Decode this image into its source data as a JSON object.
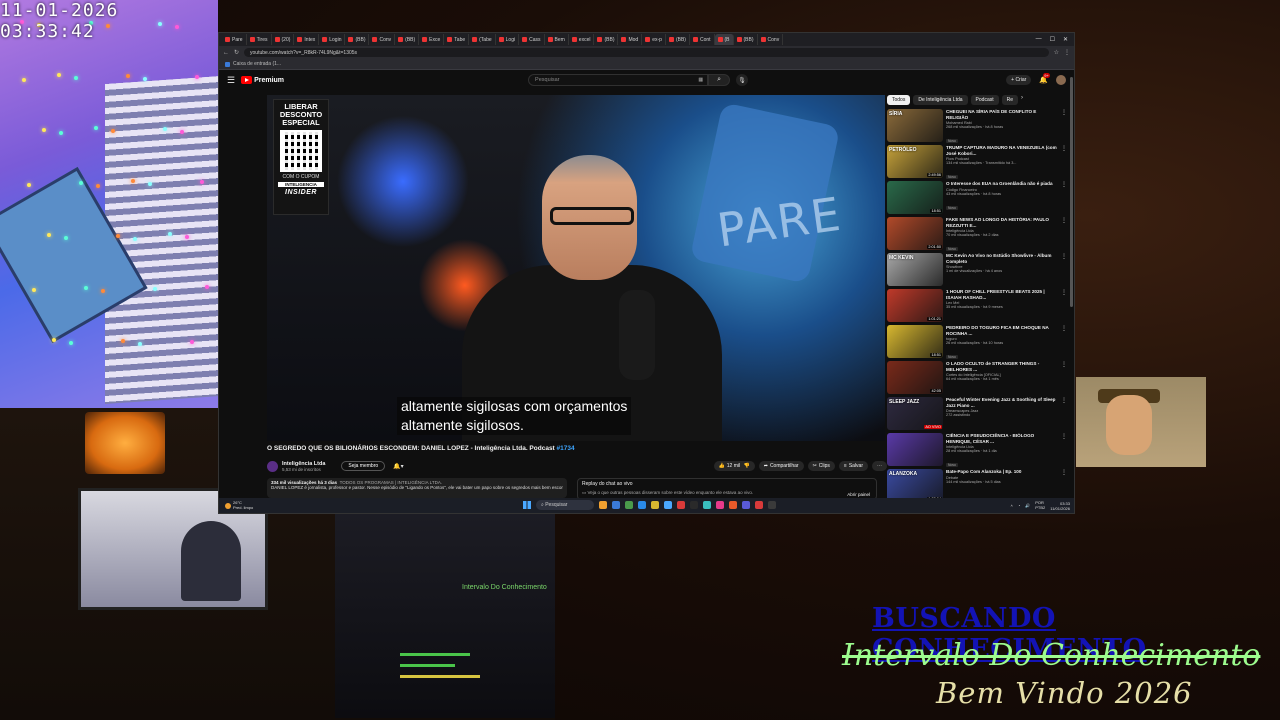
{
  "overlay": {
    "timestamp": "11-01-2026 03:33:42",
    "ticker_line1": "BUSCANDO CONHECIMENTO",
    "ticker_line2": "Intervalo Do Conhecimento",
    "ticker_line3": "Bem Vindo 2026"
  },
  "browser": {
    "tabs": [
      "Pare",
      "Tires",
      "(20)",
      "Intex",
      "Login",
      "(BB)",
      "Conv",
      "(BB)",
      "Exce",
      "Tabe",
      "(Tabe",
      "Logi",
      "Cass",
      "Bem",
      "excel",
      "(BB)",
      "Mod",
      "ex-p",
      "(BB)",
      "Cont",
      "(B",
      "(BB)",
      "Conv"
    ],
    "active_tab_index": 20,
    "url": "youtube.com/watch?v=_R8kR-74L9Ng&t=1305s",
    "bookmark": "Caixa de entrada (1..."
  },
  "youtube": {
    "logo_text": "Premium",
    "search_placeholder": "Pesquisar",
    "create_label": "Criar",
    "notif_count": "9+",
    "promo": {
      "line1": "LIBERAR DESCONTO ESPECIAL",
      "line2": "COM O CUPOM",
      "coupon": "INTELIGENCIA",
      "brand": "INSIDER"
    },
    "scene_text": "PARE",
    "subtitle_line1": "altamente sigilosas com orçamentos",
    "subtitle_line2": "altamente sigilosos.",
    "title": "O SEGREDO QUE OS BILIONÁRIOS ESCONDEM: DANIEL LOPEZ - Inteligência Ltda. Podcast",
    "title_hash": "#1734",
    "channel_name": "Inteligência Ltda",
    "channel_subs": "5,53 mi de inscritos",
    "join_label": "Seja membro",
    "actions": {
      "likes": "12 mil",
      "share": "Compartilhar",
      "clip": "Clips",
      "save": "Salvar"
    },
    "description_meta": "334 mil visualizações há 3 dias",
    "description_tags": "TODOS OS PROGRAMAS | INTELIGÊNCIA LTDA.",
    "description_body": "DANIEL LOPEZ é jornalista, professor e pastor. Nesse episódio de \"Ligando os Pontos\", ele vai bater um papo sobre os segredos mais bem escondidos dos bilionários. Já o Vilela não consegue guardar nem o segredo do cadeado de sua bicicleta, que obviamente foi roubada! ...mais",
    "chat_title": "Replay do chat ao vivo",
    "chat_text": "Veja o que outras pessoas disseram sobre este vídeo enquanto ele estava ao vivo.",
    "chat_button": "Abrir painel",
    "chips": [
      "Todos",
      "De Inteligência Ltda",
      "Podcast",
      "Re"
    ],
    "recommendations": [
      {
        "title": "CHEGUEI NA SÍRIA PAÍS DE CONFLITO E RELIGIÃO",
        "channel": "Mohamed Rabi",
        "meta": "268 mil visualizações · há 8 horas",
        "badge": "Novo",
        "duration": "",
        "color": "#8a6a3a",
        "label": "SÍRIA"
      },
      {
        "title": "TRUMP CAPTURA MADURO NA VENEZUELA (com José Kobori...",
        "channel": "Flow Podcast",
        "meta": "134 mil visualizações · Transmitido há 3...",
        "badge": "Novo",
        "duration": "2:49:56",
        "color": "#c6a23a",
        "label": "PETRÓLEO"
      },
      {
        "title": "O Interesse dos EUA na Groenlândia não é piada",
        "channel": "Código Financeiro",
        "meta": "43 mil visualizações · há 8 horas",
        "badge": "Novo",
        "duration": "18:51",
        "color": "#2a6a4a",
        "label": ""
      },
      {
        "title": "FAKE NEWS AO LONGO DA HISTÓRIA: PAULO REZZUTTI E...",
        "channel": "Inteligência Ltda",
        "meta": "70 mil visualizações · há 2 dias",
        "badge": "Novo",
        "duration": "2:01:50",
        "color": "#b24a2a",
        "label": ""
      },
      {
        "title": "MC Kevin Ao Vivo no Estúdio Showlivre - Álbum Completo",
        "channel": "Showlivre",
        "meta": "1 mi de visualizações · há 4 anos",
        "badge": "",
        "duration": "",
        "color": "#a8a8a8",
        "label": "MC KEVIN"
      },
      {
        "title": "1 HOUR OF CHILL FREESTYLE BEATS 2025 | ISAIAH RASHAD...",
        "channel": "Lex Mel",
        "meta": "35 mil visualizações · há 9 meses",
        "badge": "",
        "duration": "1:01:21",
        "color": "#c03a2a",
        "label": ""
      },
      {
        "title": "PEDREIRO DO TOGURO FICA EM CHOQUE NA ROCINHA ...",
        "channel": "toguro",
        "meta": "26 mil visualizações · há 10 horas",
        "badge": "Novo",
        "duration": "18:51",
        "color": "#d8b830",
        "label": ""
      },
      {
        "title": "O LADO OCULTO de STRANGER THINGS - MELHORES ...",
        "channel": "Cortes do Inteligência [OFICIAL]",
        "meta": "64 mil visualizações · há 1 mês",
        "badge": "",
        "duration": "42:05",
        "color": "#7a2a1a",
        "label": ""
      },
      {
        "title": "Peaceful Winter Evening Jazz & Soothing of Sleep Jazz Piano ...",
        "channel": "Dreamscapes Jazz",
        "meta": "272 assistindo",
        "badge": "",
        "duration": "AO VIVO",
        "color": "#2e2a40",
        "label": "SLEEP JAZZ"
      },
      {
        "title": "CIÊNCIA E PSEUDOCIÊNCIA - BIÓLOGO HENRIQUE, CÉSAR ...",
        "channel": "Inteligência Ltda",
        "meta": "28 mil visualizações · há 1 dia",
        "badge": "Novo",
        "duration": "",
        "color": "#5a3aa8",
        "label": ""
      },
      {
        "title": "Bate-Papo Com Alanzoka | Ep. 100",
        "channel": "Debate",
        "meta": "144 mil visualizações · há 5 dias",
        "badge": "",
        "duration": "1:23:04",
        "color": "#3a4aa0",
        "label": "ALANZOKA"
      }
    ]
  },
  "taskbar": {
    "weather_temp": "26°C",
    "weather_desc": "Pred. limpo",
    "search_label": "Pesquisar",
    "lang": "POR\nPTB2",
    "time": "03:33",
    "date": "11/01/2026"
  },
  "studio": {
    "screen_text": "Intervalo Do Conhecimento"
  },
  "colors": {
    "yt_red": "#ff0000",
    "link_blue": "#3ea6ff",
    "ticker_blue": "#1313b5",
    "ticker_green": "#9dfc8e",
    "ticker_cream": "#e6dfa8"
  }
}
